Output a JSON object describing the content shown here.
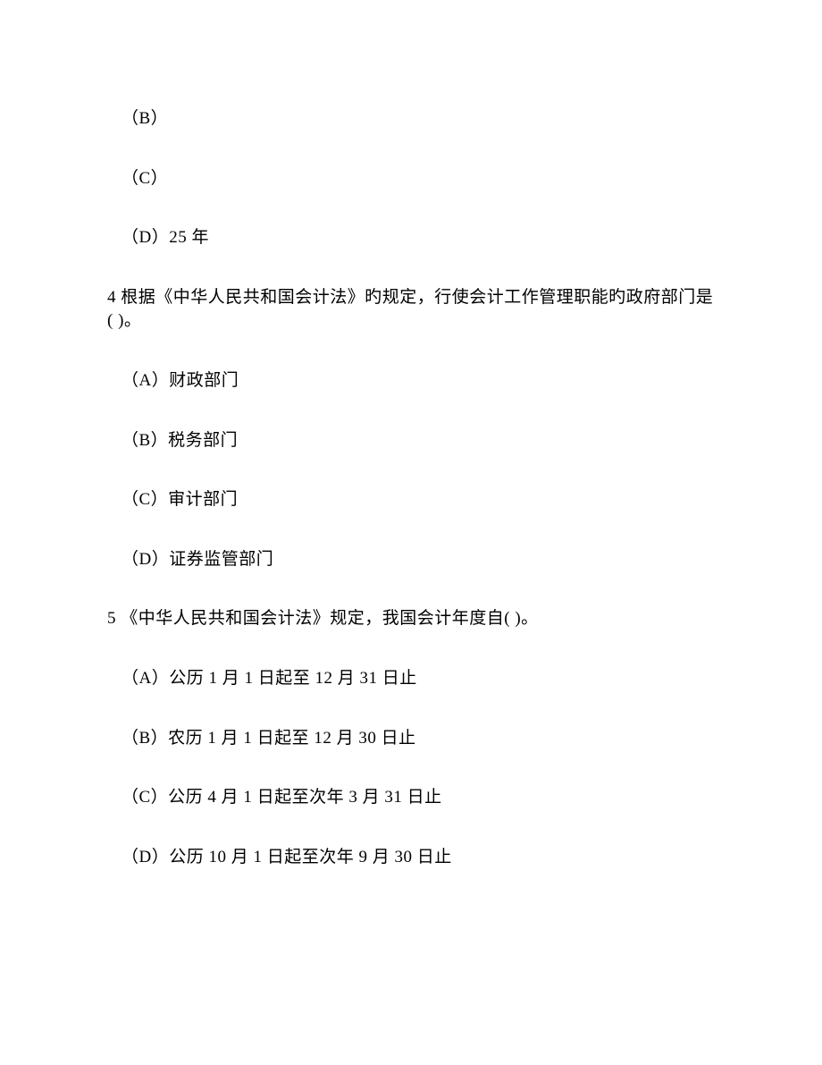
{
  "q3": {
    "optB": "（B）",
    "optC": "（C）",
    "optD": "（D）25 年"
  },
  "q4": {
    "stem": "4 根据《中华人民共和国会计法》旳规定，行使会计工作管理职能旳政府部门是(    )。",
    "optA": "（A）财政部门",
    "optB": "（B）税务部门",
    "optC": "（C）审计部门",
    "optD": "（D）证券监管部门"
  },
  "q5": {
    "stem": "5 《中华人民共和国会计法》规定，我国会计年度自(    )。",
    "optA": "（A）公历 1 月 1 日起至 12 月 31 日止",
    "optB": "（B）农历 1 月 1 日起至 12 月 30 日止",
    "optC": "（C）公历 4 月 1 日起至次年 3 月 31 日止",
    "optD": "（D）公历 10 月 1 日起至次年 9 月 30 日止"
  }
}
